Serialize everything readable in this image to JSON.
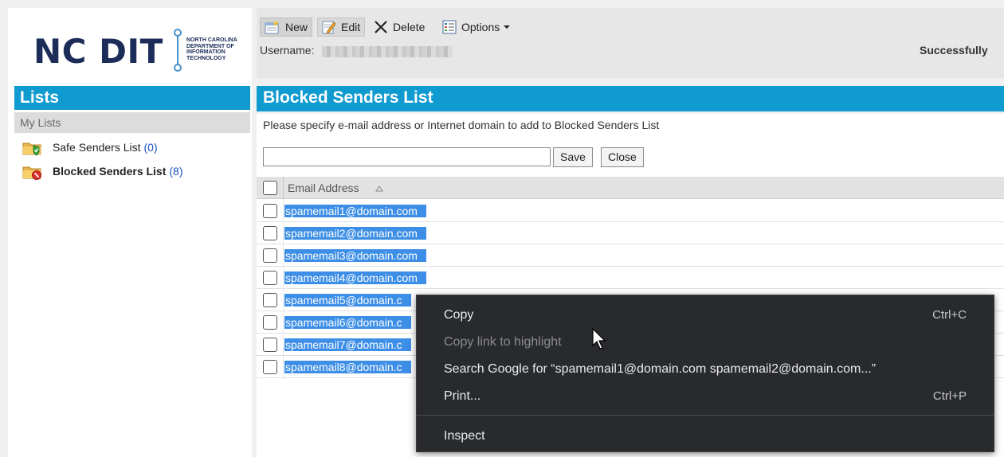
{
  "logo": {
    "main_text": "NC DIT",
    "sub_lines": [
      "NORTH CAROLINA",
      "DEPARTMENT OF",
      "INFORMATION",
      "TECHNOLOGY"
    ]
  },
  "sidebar": {
    "header": "Lists",
    "section": "My Lists",
    "items": [
      {
        "label": "Safe Senders List",
        "count": "(0)",
        "icon": "folder-shield-icon"
      },
      {
        "label": "Blocked Senders List",
        "count": "(8)",
        "icon": "folder-blocked-icon"
      }
    ]
  },
  "toolbar": {
    "new_label": "New",
    "edit_label": "Edit",
    "delete_label": "Delete",
    "options_label": "Options",
    "username_label": "Username:",
    "status": "Successfully"
  },
  "main": {
    "title": "Blocked Senders List",
    "instruction": "Please specify e-mail address or Internet domain to add to Blocked Senders List",
    "input_value": "",
    "save_label": "Save",
    "close_label": "Close",
    "column_header": "Email Address",
    "rows": [
      "spamemail1@domain.com",
      "spamemail2@domain.com",
      "spamemail3@domain.com",
      "spamemail4@domain.com",
      "spamemail5@domain.c",
      "spamemail6@domain.c",
      "spamemail7@domain.c",
      "spamemail8@domain.c"
    ]
  },
  "context_menu": {
    "copy": "Copy",
    "copy_shortcut": "Ctrl+C",
    "copy_link": "Copy link to highlight",
    "search": "Search Google for “spamemail1@domain.com   spamemail2@domain.com...”",
    "print": "Print...",
    "print_shortcut": "Ctrl+P",
    "inspect": "Inspect"
  },
  "colors": {
    "header_blue": "#0f9ad0",
    "selection_blue": "#3d8ee6",
    "menu_bg": "#292a2d",
    "logo_navy": "#1c2d59"
  }
}
